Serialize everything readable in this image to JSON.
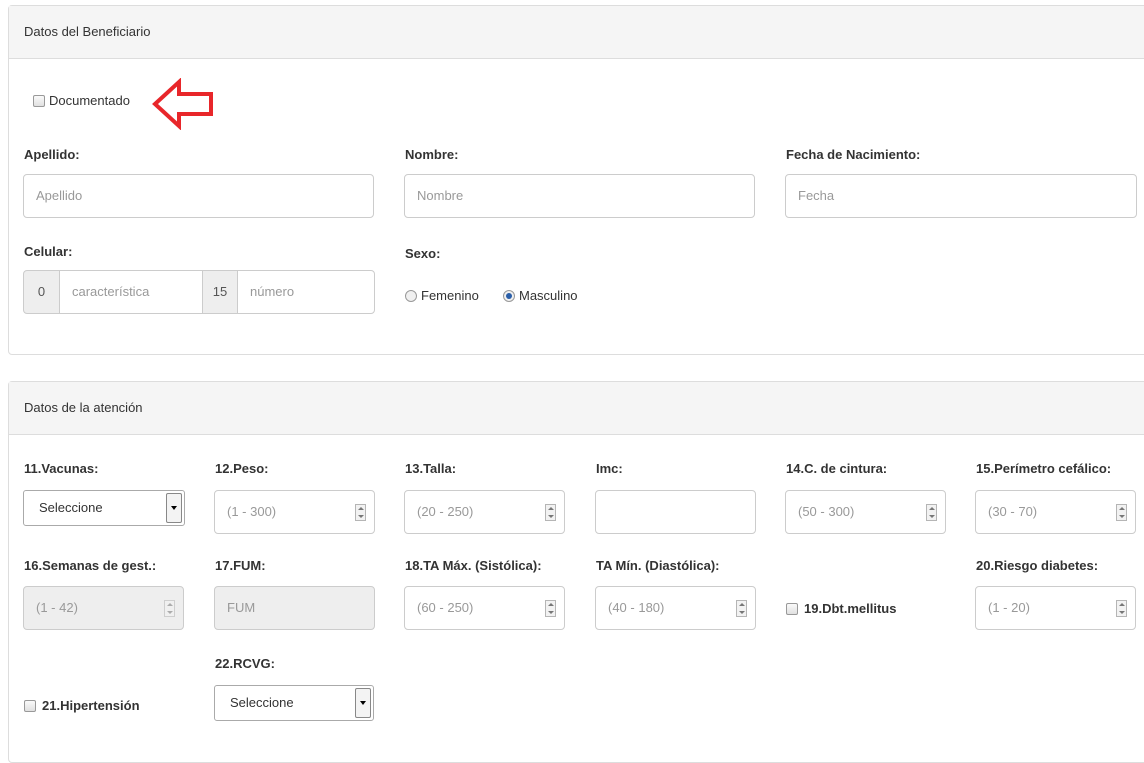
{
  "beneficiario": {
    "heading": "Datos del Beneficiario",
    "documentado_label": "Documentado",
    "apellido": {
      "label": "Apellido:",
      "placeholder": "Apellido"
    },
    "nombre": {
      "label": "Nombre:",
      "placeholder": "Nombre"
    },
    "fecha": {
      "label": "Fecha de Nacimiento:",
      "placeholder": "Fecha"
    },
    "celular": {
      "label": "Celular:",
      "prefix": "0",
      "caracteristica": "característica",
      "mid": "15",
      "numero": "número"
    },
    "sexo": {
      "label": "Sexo:",
      "options": [
        "Femenino",
        "Masculino"
      ],
      "selected": "Masculino"
    }
  },
  "atencion": {
    "heading": "Datos de la atención",
    "vacunas": {
      "label": "11.Vacunas:",
      "value": "Seleccione"
    },
    "peso": {
      "label": "12.Peso:",
      "placeholder": "(1 - 300)"
    },
    "talla": {
      "label": "13.Talla:",
      "placeholder": "(20 - 250)"
    },
    "imc": {
      "label": "Imc:"
    },
    "cintura": {
      "label": "14.C. de cintura:",
      "placeholder": "(50 - 300)"
    },
    "perimetro": {
      "label": "15.Perímetro cefálico:",
      "placeholder": "(30 - 70)"
    },
    "semanas": {
      "label": "16.Semanas de gest.:",
      "placeholder": "(1 - 42)"
    },
    "fum": {
      "label": "17.FUM:",
      "placeholder": "FUM"
    },
    "ta_max": {
      "label": "18.TA Máx. (Sistólica):",
      "placeholder": "(60 - 250)"
    },
    "ta_min": {
      "label": "TA Mín. (Diastólica):",
      "placeholder": "(40 - 180)"
    },
    "dbt": {
      "label": "19.Dbt.mellitus"
    },
    "riesgo": {
      "label": "20.Riesgo diabetes:",
      "placeholder": "(1 - 20)"
    },
    "hipertension": {
      "label": "21.Hipertensión"
    },
    "rcvg": {
      "label": "22.RCVG:",
      "value": "Seleccione"
    }
  },
  "annotation": {
    "arrow_color": "#e8262a",
    "arrow_icon": "left-arrow-outline-icon"
  }
}
